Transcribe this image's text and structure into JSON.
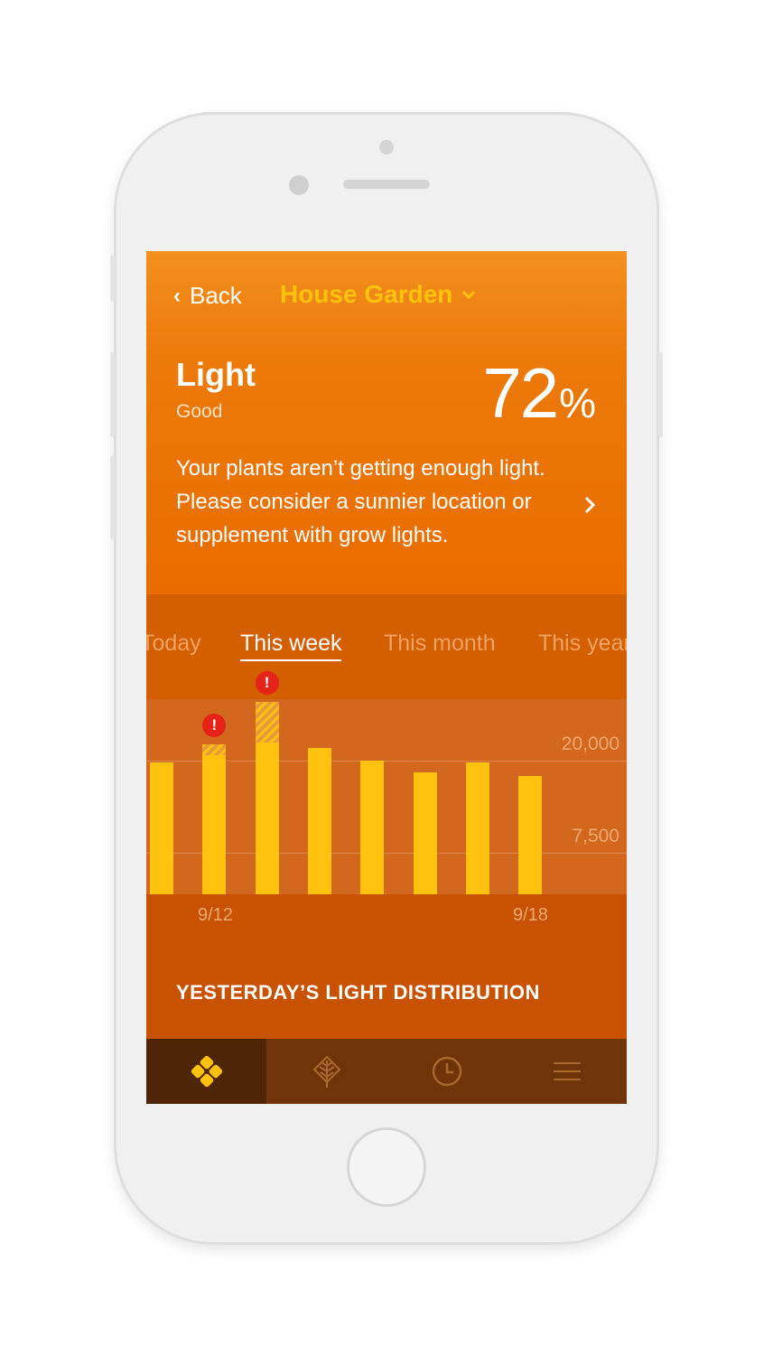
{
  "nav": {
    "back_label": "Back",
    "garden_name": "House Garden"
  },
  "metric": {
    "title": "Light",
    "status": "Good",
    "percent_value": "72",
    "percent_symbol": "%",
    "message_line1": "Your plants aren’t getting enough light.",
    "message_line2": "Please consider a sunnier location or",
    "message_line3": "supplement with grow lights."
  },
  "periods": {
    "items": [
      "Today",
      "This week",
      "This month",
      "This year"
    ],
    "selected": "This week"
  },
  "chart_data": {
    "type": "bar",
    "title": "",
    "xlabel": "",
    "ylabel": "",
    "categories": [
      "",
      "9/12",
      "",
      "",
      "",
      "",
      "",
      "9/18"
    ],
    "visible_x_labels": [
      "9/12",
      "9/18"
    ],
    "values": [
      12500,
      14200,
      18200,
      13900,
      12700,
      11600,
      12500,
      11200
    ],
    "excess": [
      0,
      1000,
      3800,
      0,
      0,
      0,
      0,
      0
    ],
    "alerts": [
      false,
      true,
      true,
      false,
      false,
      false,
      false,
      false
    ],
    "alert_symbol": "!",
    "y_ticks": [
      "20,000",
      "7,500"
    ],
    "grid": true,
    "colors": {
      "bar": "#ffc20e",
      "alert": "#e52318"
    }
  },
  "distribution": {
    "title": "YESTERDAY’S LIGHT DISTRIBUTION"
  },
  "tabbar": {
    "items": [
      {
        "icon": "clover-icon",
        "active": true
      },
      {
        "icon": "leaf-icon",
        "active": false
      },
      {
        "icon": "clock-icon",
        "active": false
      },
      {
        "icon": "menu-icon",
        "active": false
      }
    ]
  },
  "colors": {
    "header_top": "#f2901e",
    "header_bottom": "#e96c00",
    "accent_yellow": "#ffc20e",
    "tabbar": "#6f3408"
  }
}
